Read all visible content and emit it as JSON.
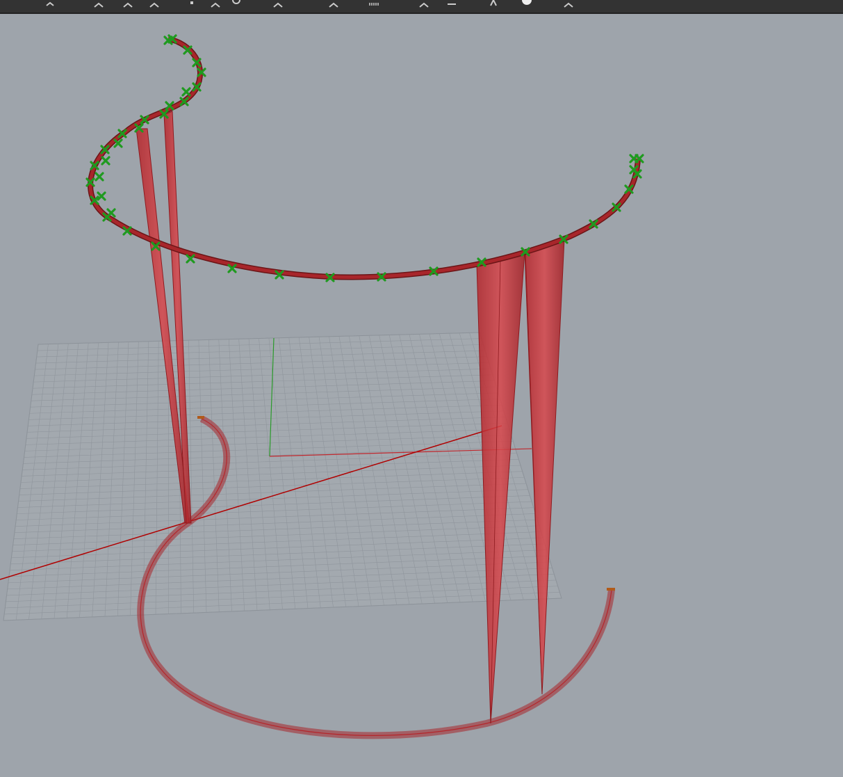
{
  "toolbar": {
    "buttons": [
      {
        "icon": "open-file-icon"
      },
      {
        "icon": "save-icon"
      },
      {
        "icon": "undo-icon"
      },
      {
        "icon": "redo-icon"
      },
      {
        "icon": "cursor-icon"
      },
      {
        "icon": "zoom-icon"
      },
      {
        "icon": "rotate-icon"
      },
      {
        "icon": "pan-icon"
      },
      {
        "icon": "grid-icon"
      },
      {
        "icon": "layer-icon"
      },
      {
        "icon": "select-icon"
      },
      {
        "icon": "curve-icon"
      },
      {
        "icon": "sphere-icon"
      },
      {
        "icon": "options-icon"
      }
    ]
  },
  "viewport": {
    "background_color": "#9ea4ab",
    "grid_color": "#8a9097",
    "x_axis_color": "#b00000",
    "y_axis_color": "#2a9a2a",
    "geometry_color": "#c0272d",
    "control_point_color": "#1f9a1f"
  }
}
